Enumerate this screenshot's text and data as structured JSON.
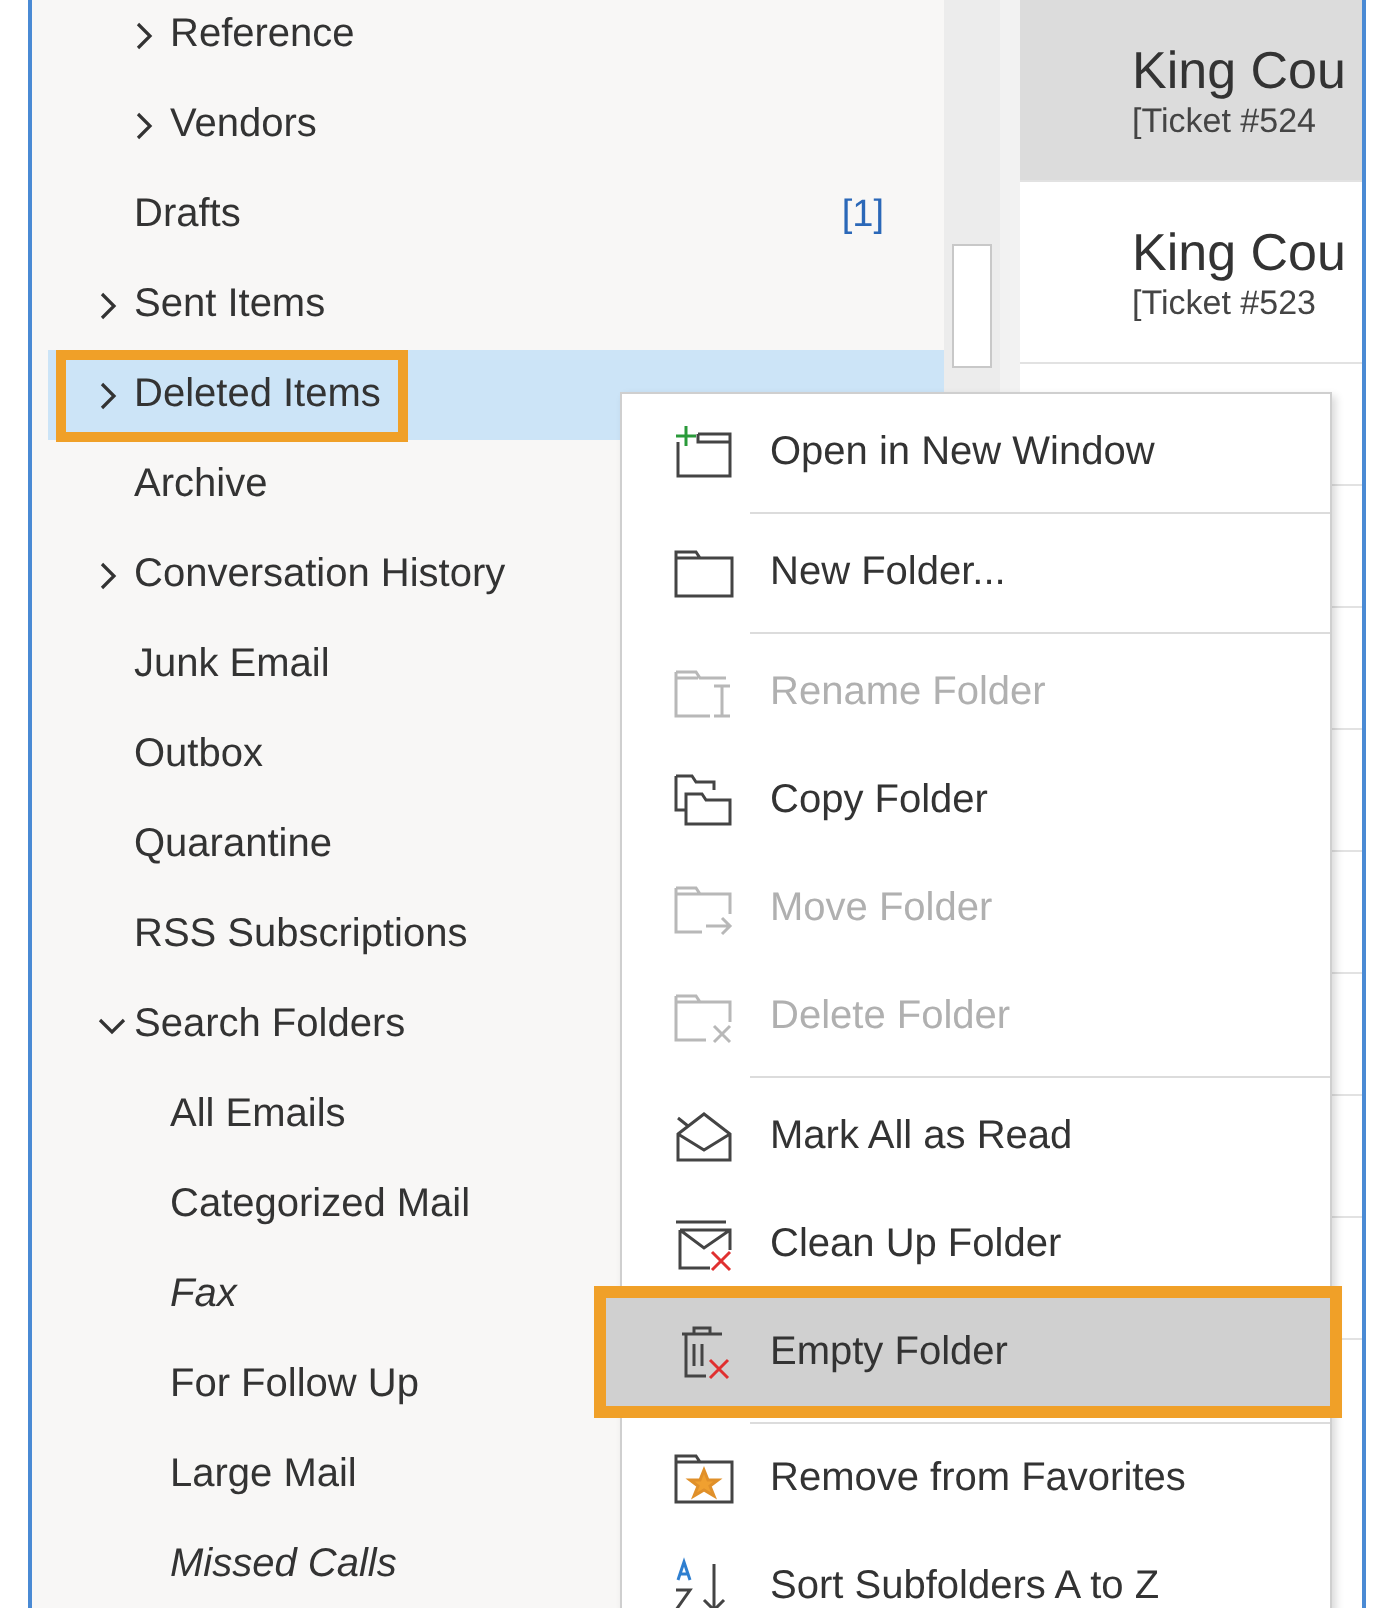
{
  "folders": [
    {
      "children": [
        {
          "label": "Reference",
          "expandable": true,
          "expanded": false
        },
        {
          "label": "Vendors",
          "expandable": true,
          "expanded": false
        }
      ]
    },
    {
      "label": "Drafts",
      "count": "[1]"
    },
    {
      "label": "Sent Items",
      "expandable": true,
      "expanded": false
    },
    {
      "label": "Deleted Items",
      "expandable": true,
      "expanded": false,
      "selected": true,
      "annotated": true
    },
    {
      "label": "Archive"
    },
    {
      "label": "Conversation History",
      "expandable": true,
      "expanded": false
    },
    {
      "label": "Junk Email"
    },
    {
      "label": "Outbox"
    },
    {
      "label": "Quarantine"
    },
    {
      "label": "RSS Subscriptions"
    },
    {
      "label": "Search Folders",
      "expandable": true,
      "expanded": true,
      "children": [
        {
          "label": "All Emails"
        },
        {
          "label": "Categorized Mail"
        },
        {
          "label": "Fax",
          "italic": true
        },
        {
          "label": "For Follow Up"
        },
        {
          "label": "Large Mail"
        },
        {
          "label": "Missed Calls",
          "italic": true
        }
      ]
    }
  ],
  "messages": [
    {
      "sender": "King Cou",
      "subject": "[Ticket #524",
      "selected": true
    },
    {
      "sender": "King Cou",
      "subject": "[Ticket #523",
      "selected": false
    }
  ],
  "context_menu": [
    {
      "text": "Open in New Window",
      "disabled": false,
      "highlighted": false,
      "separator_after": true
    },
    {
      "text": "New Folder...",
      "disabled": false,
      "highlighted": false,
      "separator_after": true
    },
    {
      "text": "Rename Folder",
      "disabled": true,
      "highlighted": false
    },
    {
      "text": "Copy Folder",
      "disabled": false,
      "highlighted": false
    },
    {
      "text": "Move Folder",
      "disabled": true,
      "highlighted": false
    },
    {
      "text": "Delete Folder",
      "disabled": true,
      "highlighted": false,
      "separator_after": true
    },
    {
      "text": "Mark All as Read",
      "disabled": false,
      "highlighted": false
    },
    {
      "text": "Clean Up Folder",
      "disabled": false,
      "highlighted": false
    },
    {
      "text": "Empty Folder",
      "disabled": false,
      "highlighted": true,
      "annotated": true,
      "separator_after": true
    },
    {
      "text": "Remove from Favorites",
      "disabled": false,
      "highlighted": false
    },
    {
      "text": "Sort Subfolders A to Z",
      "disabled": false,
      "highlighted": false
    }
  ]
}
